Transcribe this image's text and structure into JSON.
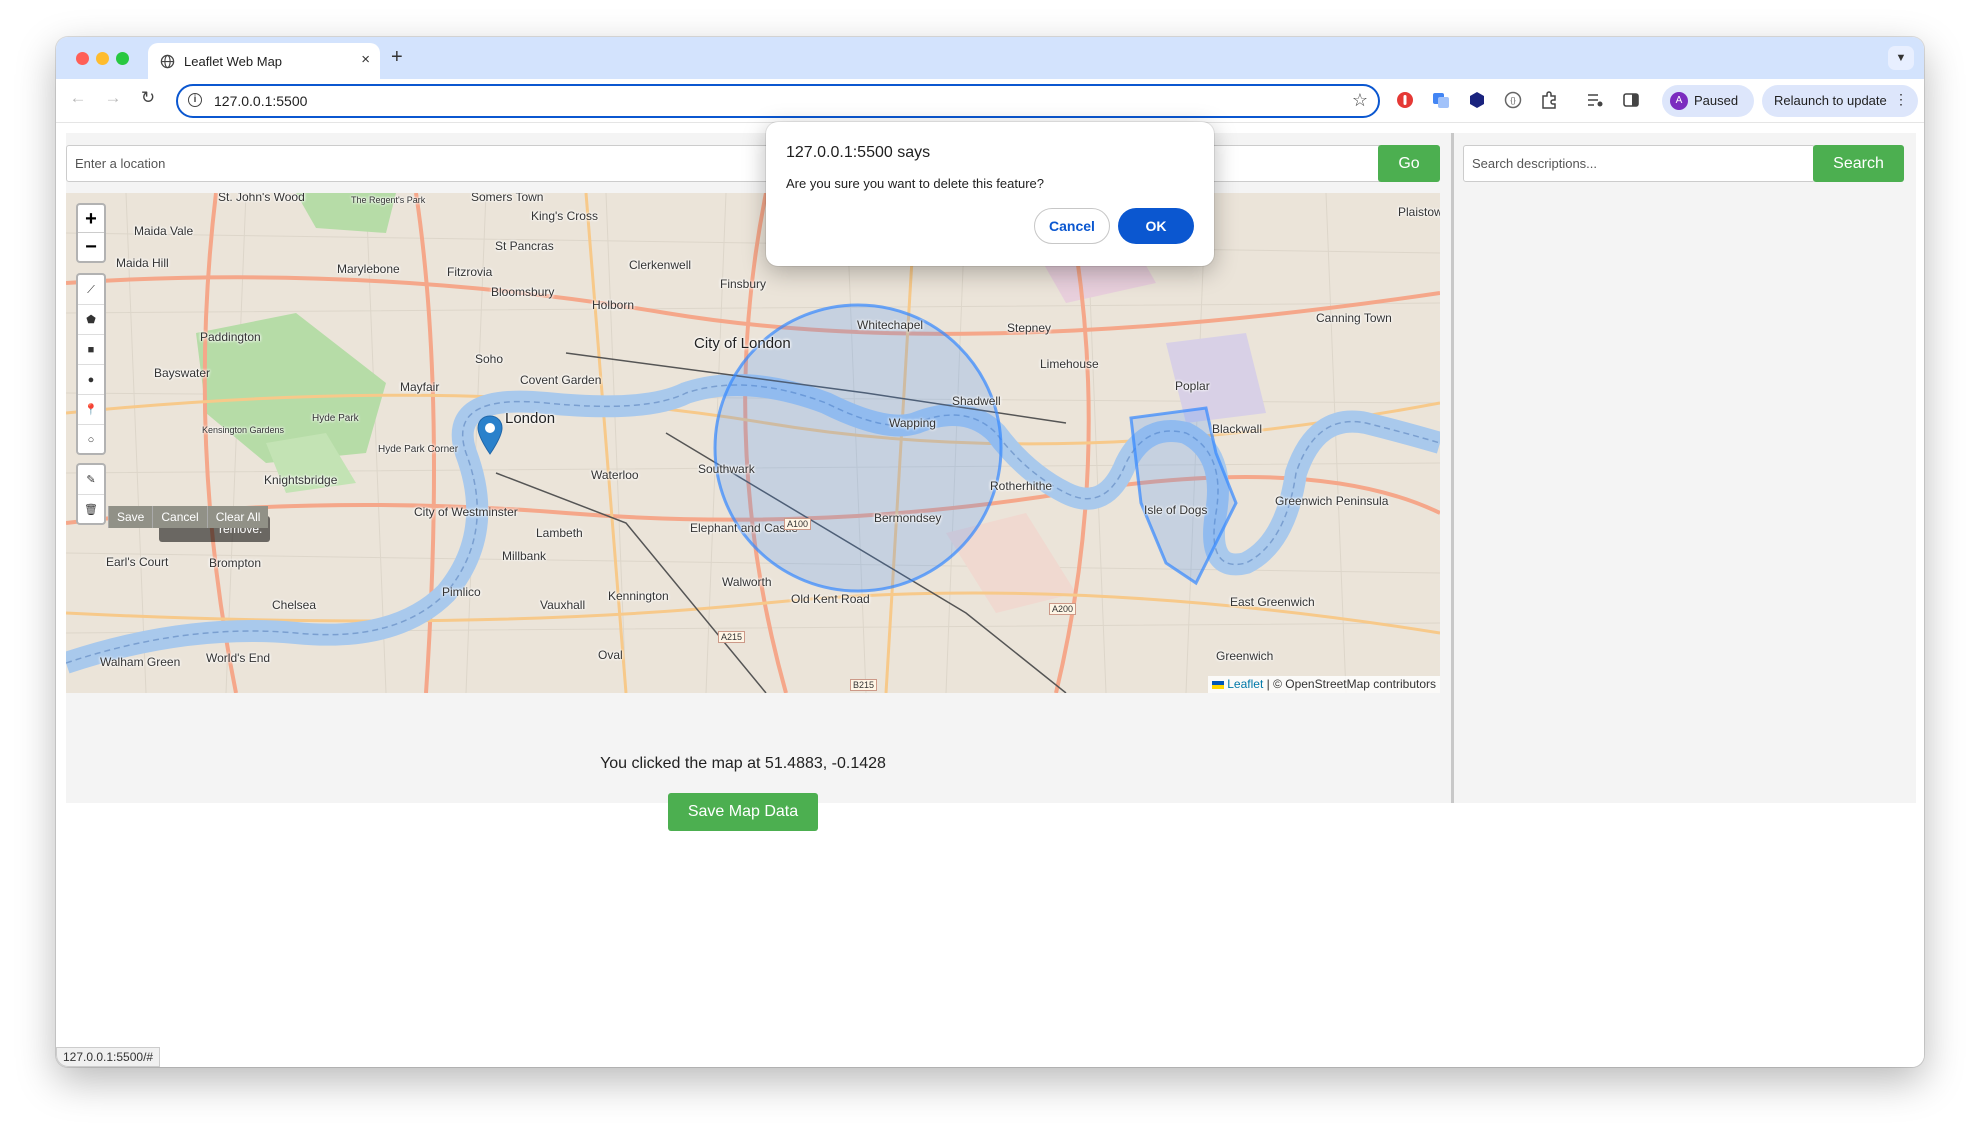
{
  "browser": {
    "tab_title": "Leaflet Web Map",
    "tab_close": "×",
    "new_tab": "+",
    "url": "127.0.0.1:5500",
    "profile_avatar": "A",
    "profile_label": "Paused",
    "relaunch_label": "Relaunch to update",
    "status_url": "127.0.0.1:5500/#"
  },
  "search": {
    "location_placeholder": "Enter a location",
    "go_label": "Go",
    "desc_placeholder": "Search descriptions...",
    "search_label": "Search"
  },
  "map": {
    "zoom_in": "+",
    "zoom_out": "−",
    "edit_actions": [
      "Save",
      "Cancel",
      "Clear All"
    ],
    "tooltip_fragment": "remove.",
    "attribution_link": "Leaflet",
    "attribution_text": "| © OpenStreetMap contributors",
    "places": [
      "St. John's Wood",
      "The Regent's Park",
      "Somers Town",
      "King's Cross",
      "Maida Vale",
      "Maida Hill",
      "Marylebone",
      "St Pancras",
      "Fitzrovia",
      "Clerkenwell",
      "Finsbury",
      "Bloomsbury",
      "Holborn",
      "Paddington",
      "City of London",
      "Whitechapel",
      "Stepney",
      "Bayswater",
      "Soho",
      "Covent Garden",
      "Mayfair",
      "Limehouse",
      "Poplar",
      "Canning Town",
      "Shadwell",
      "Kensington Gardens",
      "Hyde Park",
      "London",
      "Wapping",
      "Blackwall",
      "Hyde Park Corner",
      "Knightsbridge",
      "Southwark",
      "Waterloo",
      "Rotherhithe",
      "Isle of Dogs",
      "Greenwich Peninsula",
      "City of Westminster",
      "Bermondsey",
      "Elephant and Castle",
      "Lambeth",
      "Millbank",
      "Earl's Court",
      "Brompton",
      "Pimlico",
      "Walworth",
      "Old Kent Road",
      "Kennington",
      "Chelsea",
      "Vauxhall",
      "East Greenwich",
      "Oval",
      "Walham Green",
      "World's End",
      "Greenwich",
      "Plaistow"
    ],
    "roads": [
      "A100",
      "A200",
      "A215",
      "B215"
    ]
  },
  "coords_text": "You clicked the map at 51.4883, -0.1428",
  "save_map_label": "Save Map Data",
  "dialog": {
    "title": "127.0.0.1:5500 says",
    "message": "Are you sure you want to delete this feature?",
    "cancel_label": "Cancel",
    "ok_label": "OK"
  },
  "colors": {
    "accent_green": "#4caf50",
    "dialog_blue": "#0b57d0",
    "circle_fill": "#3388ff"
  }
}
